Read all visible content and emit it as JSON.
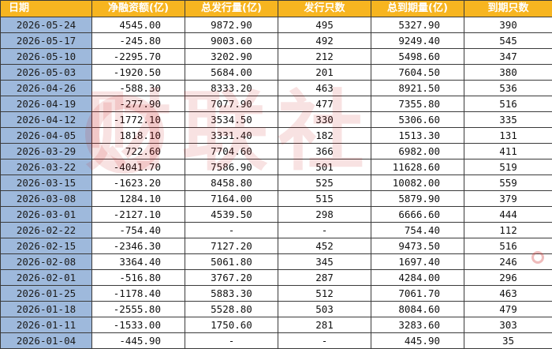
{
  "table": {
    "headers": [
      "日期",
      "净融资额(亿)",
      "总发行量(亿)",
      "发行只数",
      "总到期量(亿)",
      "到期只数"
    ],
    "rows": [
      [
        "2026-05-24",
        "4545.00",
        "9872.90",
        "495",
        "5327.90",
        "390"
      ],
      [
        "2026-05-17",
        "-245.80",
        "9003.60",
        "492",
        "9249.40",
        "545"
      ],
      [
        "2026-05-10",
        "-2295.70",
        "3202.90",
        "212",
        "5498.60",
        "347"
      ],
      [
        "2026-05-03",
        "-1920.50",
        "5684.00",
        "201",
        "7604.50",
        "380"
      ],
      [
        "2026-04-26",
        "-588.30",
        "8333.20",
        "463",
        "8921.50",
        "536"
      ],
      [
        "2026-04-19",
        "-277.90",
        "7077.90",
        "477",
        "7355.80",
        "516"
      ],
      [
        "2026-04-12",
        "-1772.10",
        "3534.50",
        "330",
        "5306.60",
        "335"
      ],
      [
        "2026-04-05",
        "1818.10",
        "3331.40",
        "182",
        "1513.30",
        "131"
      ],
      [
        "2026-03-29",
        "722.60",
        "7704.60",
        "366",
        "6982.00",
        "411"
      ],
      [
        "2026-03-22",
        "-4041.70",
        "7586.90",
        "501",
        "11628.60",
        "519"
      ],
      [
        "2026-03-15",
        "-1623.20",
        "8458.80",
        "525",
        "10082.00",
        "559"
      ],
      [
        "2026-03-08",
        "1284.10",
        "7164.00",
        "515",
        "5879.90",
        "379"
      ],
      [
        "2026-03-01",
        "-2127.10",
        "4539.50",
        "298",
        "6666.60",
        "444"
      ],
      [
        "2026-02-22",
        "-754.40",
        "-",
        "-",
        "754.40",
        "112"
      ],
      [
        "2026-02-15",
        "-2346.30",
        "7127.20",
        "452",
        "9473.50",
        "516"
      ],
      [
        "2026-02-08",
        "3364.40",
        "5061.80",
        "345",
        "1697.40",
        "246"
      ],
      [
        "2026-02-01",
        "-516.80",
        "3767.20",
        "287",
        "4284.00",
        "296"
      ],
      [
        "2026-01-25",
        "-1178.40",
        "5883.30",
        "512",
        "7061.70",
        "463"
      ],
      [
        "2026-01-18",
        "-2555.80",
        "5528.80",
        "503",
        "8084.60",
        "479"
      ],
      [
        "2026-01-11",
        "-1533.00",
        "1750.60",
        "281",
        "3283.60",
        "303"
      ],
      [
        "2026-01-04",
        "-445.90",
        "-",
        "-",
        "445.90",
        "35"
      ]
    ]
  },
  "watermark": {
    "text": "财联社"
  },
  "colors": {
    "header_bg": "#f7b520",
    "date_bg": "#9eb9dc",
    "watermark": "#c81e1e"
  }
}
